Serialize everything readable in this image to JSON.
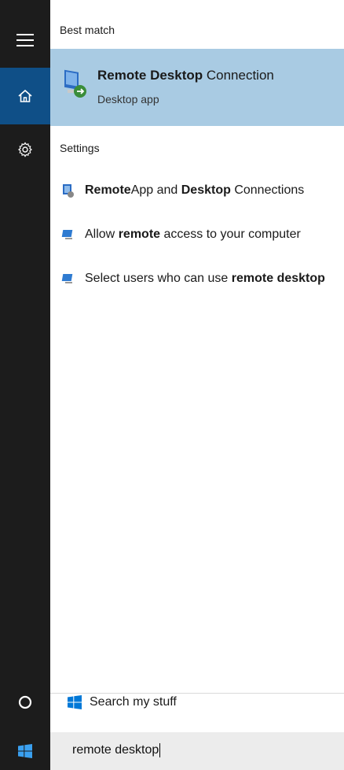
{
  "sections": {
    "best_match": "Best match",
    "settings": "Settings"
  },
  "best_match_item": {
    "title_bold": "Remote Desktop",
    "title_rest": " Connection",
    "subtitle": "Desktop app"
  },
  "settings_items": [
    {
      "parts": [
        {
          "b": "Remote"
        },
        {
          "t": "App and "
        },
        {
          "b": "Desktop"
        },
        {
          "t": " Connections"
        }
      ]
    },
    {
      "parts": [
        {
          "t": "Allow "
        },
        {
          "b": "remote"
        },
        {
          "t": " access to your computer"
        }
      ]
    },
    {
      "parts": [
        {
          "t": "Select users who can use "
        },
        {
          "b": "remote desktop"
        }
      ]
    }
  ],
  "search_my_stuff": "Search my stuff",
  "search_query": "remote desktop",
  "colors": {
    "rail": "#1c1c1c",
    "rail_selected": "#0f4f87",
    "highlight": "#a9cbe3",
    "search_bg": "#ececec"
  },
  "icons": [
    "hamburger-menu-icon",
    "home-icon",
    "settings-gear-icon",
    "cortana-circle-icon",
    "windows-logo-icon",
    "remote-desktop-icon",
    "remoteapp-icon",
    "monitor-icon"
  ]
}
